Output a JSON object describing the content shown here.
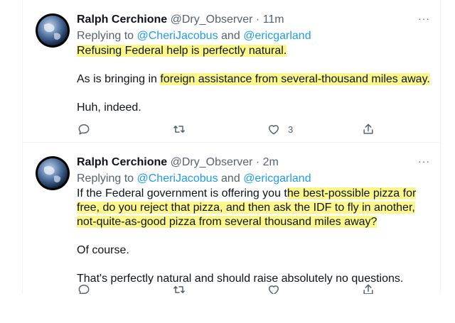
{
  "tweets": [
    {
      "author_name": "Ralph Cerchione",
      "author_handle": "@Dry_Observer",
      "separator": "·",
      "time": "11m",
      "more_icon": "···",
      "reply_prefix": "Replying to",
      "reply_mention_1": "@CheriJacobus",
      "reply_and": "and",
      "reply_mention_2": "@ericgarland",
      "para1_hl": "Refusing Federal help is perfectly natural.",
      "para2_plain": "As is bringing in ",
      "para2_hl": "foreign assistance from several-thousand miles away.",
      "para3": "Huh, indeed.",
      "like_count": "3"
    },
    {
      "author_name": "Ralph Cerchione",
      "author_handle": "@Dry_Observer",
      "separator": "·",
      "time": "2m",
      "more_icon": "···",
      "reply_prefix": "Replying to",
      "reply_mention_1": "@CheriJacobus",
      "reply_and": "and",
      "reply_mention_2": "@ericgarland",
      "para1_plain": "If the Federal government is offering you t",
      "para1_hl": "he best-possible pizza for free, do you reject that pizza, and then ask the IDF to fly in another, not-quite-as-good pizza from several thousand miles away?",
      "para2": "Of course.",
      "para3": "That's perfectly natural and should raise absolutely no questions."
    }
  ],
  "colors": {
    "highlight": "#fbf78a",
    "link": "#1d9bf0",
    "muted": "#536471"
  },
  "icons": [
    "reply-icon",
    "retweet-icon",
    "like-icon",
    "share-icon",
    "globe-avatar"
  ]
}
